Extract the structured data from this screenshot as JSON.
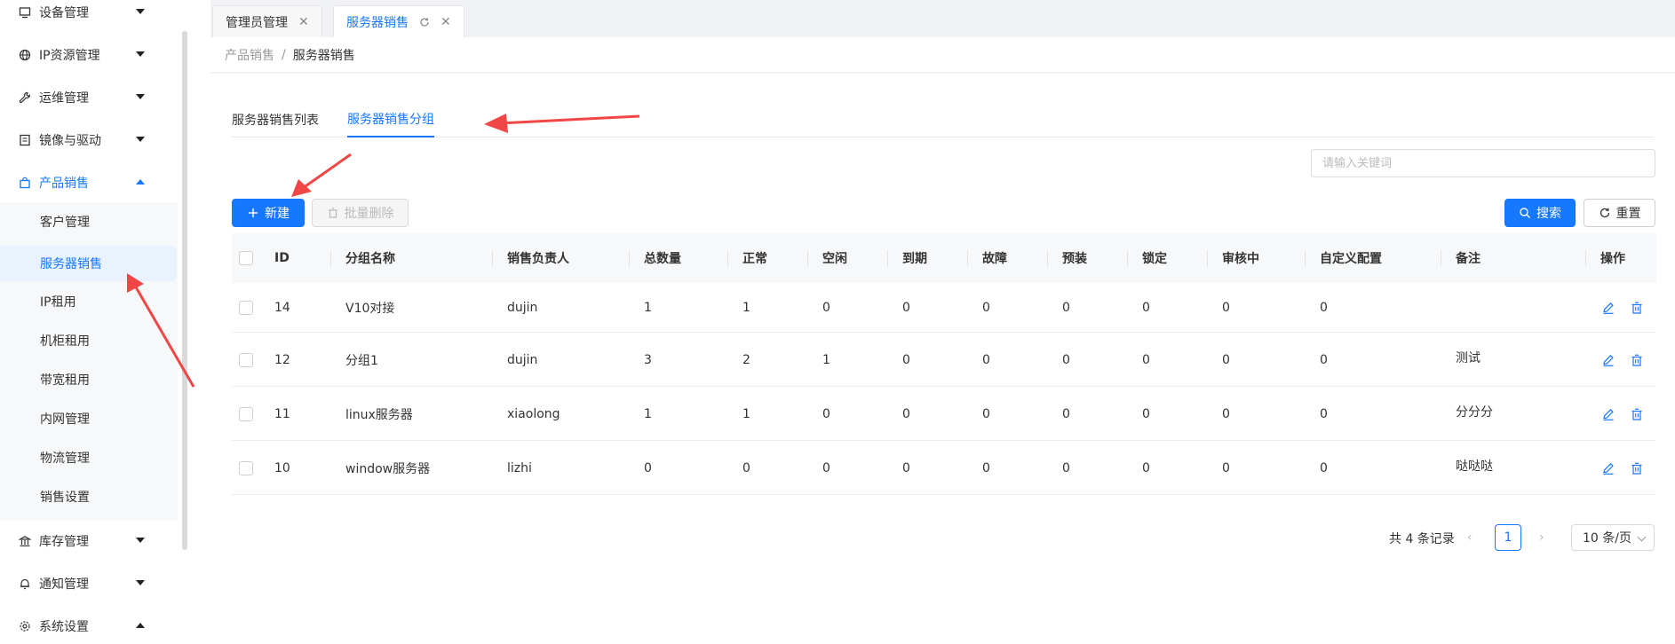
{
  "sidebar": {
    "menu": [
      {
        "label": "设备管理",
        "icon": "monitor-icon",
        "expanded": false
      },
      {
        "label": "IP资源管理",
        "icon": "globe-icon",
        "expanded": false
      },
      {
        "label": "运维管理",
        "icon": "wrench-icon",
        "expanded": false
      },
      {
        "label": "镜像与驱动",
        "icon": "disk-image-icon",
        "expanded": false
      },
      {
        "label": "产品销售",
        "icon": "shopping-bag-icon",
        "expanded": true
      },
      {
        "label": "库存管理",
        "icon": "bank-icon",
        "expanded": false
      },
      {
        "label": "通知管理",
        "icon": "bell-icon",
        "expanded": false
      },
      {
        "label": "系统设置",
        "icon": "settings-icon",
        "expanded": true
      }
    ],
    "submenu": [
      "客户管理",
      "服务器销售",
      "IP租用",
      "机柜租用",
      "带宽租用",
      "内网管理",
      "物流管理",
      "销售设置"
    ],
    "active_submenu": "服务器销售"
  },
  "tabs": [
    {
      "label": "管理员管理",
      "active": false
    },
    {
      "label": "服务器销售",
      "active": true
    }
  ],
  "breadcrumb": {
    "parent": "产品销售",
    "sep": "/",
    "current": "服务器销售"
  },
  "subtabs": [
    {
      "label": "服务器销售列表",
      "active": false
    },
    {
      "label": "服务器销售分组",
      "active": true
    }
  ],
  "search": {
    "placeholder": "请输入关键词",
    "value": ""
  },
  "toolbar": {
    "new_label": "新建",
    "batch_delete_label": "批量删除",
    "search_label": "搜索",
    "reset_label": "重置"
  },
  "table": {
    "columns": [
      "ID",
      "分组名称",
      "销售负责人",
      "总数量",
      "正常",
      "空闲",
      "到期",
      "故障",
      "预装",
      "锁定",
      "审核中",
      "自定义配置",
      "备注",
      "操作"
    ],
    "rows": [
      [
        "14",
        "V10对接",
        "dujin",
        "1",
        "1",
        "0",
        "0",
        "0",
        "0",
        "0",
        "0",
        "0",
        ""
      ],
      [
        "12",
        "分组1",
        "dujin",
        "3",
        "2",
        "1",
        "0",
        "0",
        "0",
        "0",
        "0",
        "0",
        "测试"
      ],
      [
        "11",
        "linux服务器",
        "xiaolong",
        "1",
        "1",
        "0",
        "0",
        "0",
        "0",
        "0",
        "0",
        "0",
        "分分分"
      ],
      [
        "10",
        "window服务器",
        "lizhi",
        "0",
        "0",
        "0",
        "0",
        "0",
        "0",
        "0",
        "0",
        "0",
        "哒哒哒"
      ]
    ]
  },
  "pagination": {
    "total": "共 4 条记录",
    "prev": "‹",
    "current_page": "1",
    "next": "›",
    "page_size": "10 条/页"
  },
  "colors": {
    "primary": "#1677ff",
    "annotation": "#f04646"
  }
}
